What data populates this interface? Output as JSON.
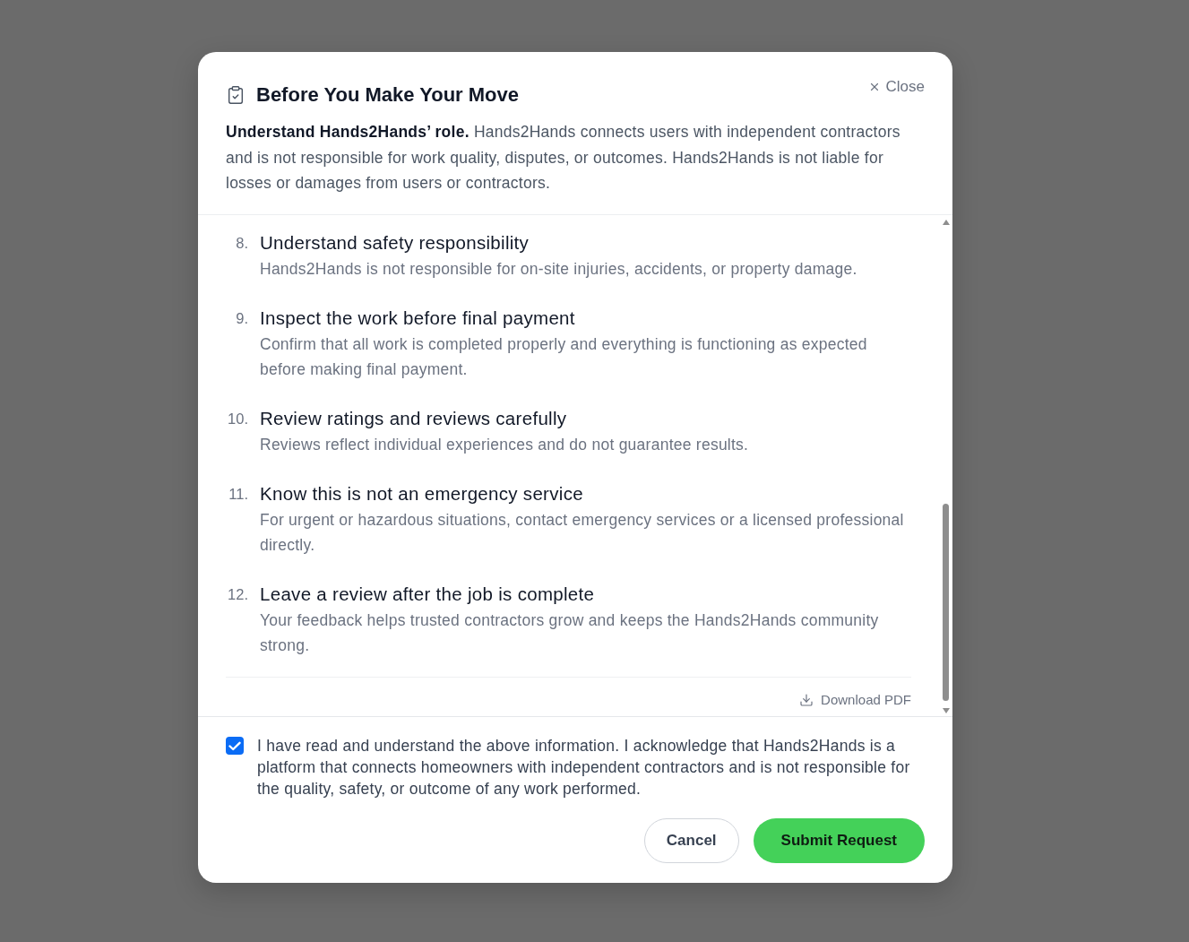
{
  "dialog": {
    "title": "Before You Make Your Move",
    "close_label": "Close",
    "intro": "**Understand Hands2Hands’ role.** Hands2Hands connects users with independent contractors and is not responsible for work quality, disputes, or outcomes. Hands2Hands is not liable for losses or damages from users or contractors."
  },
  "steps": [
    {
      "number": "8.",
      "title": "Understand safety responsibility",
      "description": "Hands2Hands is not responsible for on-site injuries, accidents, or property damage."
    },
    {
      "number": "9.",
      "title": "Inspect the work before final payment",
      "description": "Confirm that all work is completed properly and everything is functioning as expected before making final payment."
    },
    {
      "number": "10.",
      "title": "Review ratings and reviews carefully",
      "description": "Reviews reflect individual experiences and do not guarantee results."
    },
    {
      "number": "11.",
      "title": "Know this is not an emergency service",
      "description": "For urgent or hazardous situations, contact emergency services or a licensed professional directly."
    },
    {
      "number": "12.",
      "title": "Leave a review after the job is complete",
      "description": "Your feedback helps trusted contractors grow and keeps the Hands2Hands community strong."
    }
  ],
  "download": {
    "label": "Download PDF"
  },
  "acknowledgement": {
    "checked": true,
    "text": "I have read and understand the above information. I acknowledge that Hands2Hands is a platform that connects homeowners with independent contractors and is not responsible for the quality, safety, or outcome of any work performed."
  },
  "buttons": [
    {
      "kind": "secondary",
      "label": "Cancel"
    },
    {
      "kind": "primary",
      "label": "Submit Request"
    }
  ]
}
